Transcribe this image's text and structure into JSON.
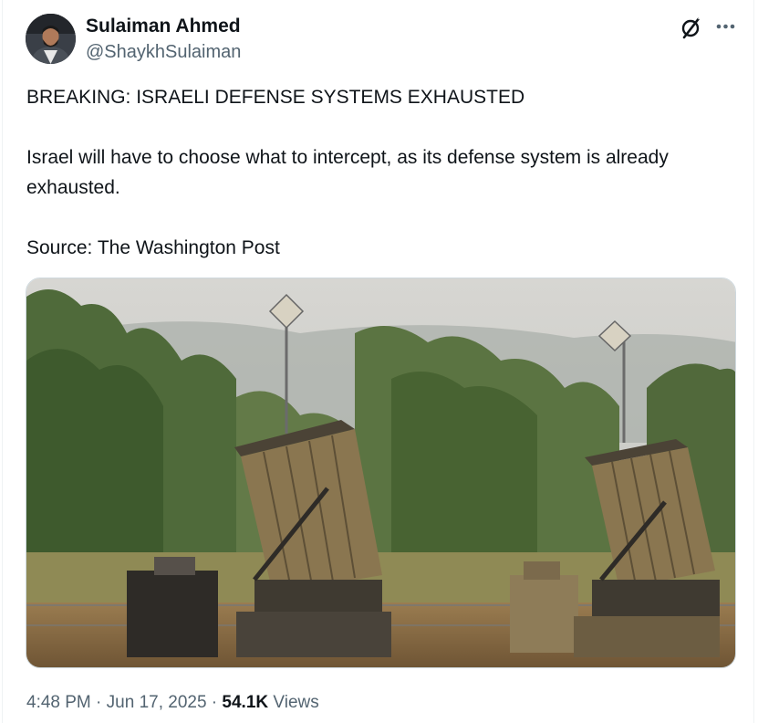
{
  "author": {
    "name": "Sulaiman Ahmed",
    "handle": "@ShaykhSulaiman"
  },
  "header_actions": {
    "grok_icon": "grok-icon",
    "more_icon": "more-options-icon"
  },
  "tweet": {
    "line1": "BREAKING: ISRAELI DEFENSE SYSTEMS EXHAUSTED",
    "line2": "Israel will have to choose what to intercept, as its defense system is already exhausted.",
    "line3": "Source: The Washington Post"
  },
  "meta": {
    "time": "4:48 PM",
    "separator1": " · ",
    "date": "Jun 17, 2025",
    "separator2": " · ",
    "views_count": "54.1K",
    "views_label": " Views"
  },
  "colors": {
    "text_primary": "#0f1419",
    "text_secondary": "#536471",
    "border": "#cfd9de"
  }
}
